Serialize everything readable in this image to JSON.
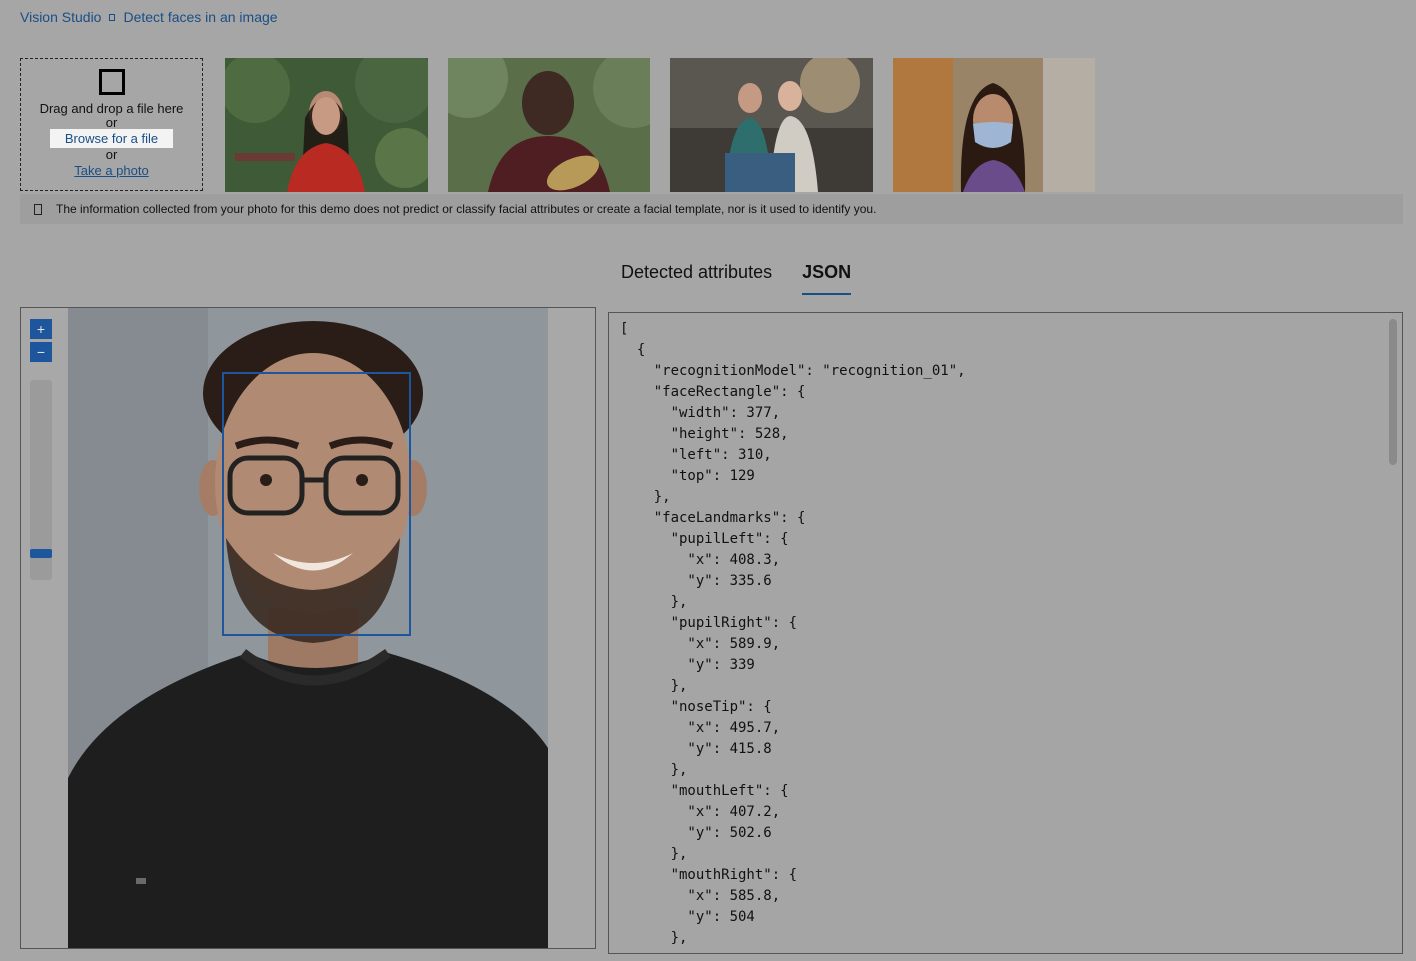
{
  "breadcrumb": {
    "root": "Vision Studio",
    "current": "Detect faces in an image"
  },
  "upload": {
    "drag_text": "Drag and drop a file here",
    "or_1": "or",
    "browse_label": "Browse for a file",
    "or_2": "or",
    "take_photo_label": "Take a photo"
  },
  "info": {
    "text": "The information collected from your photo for this demo does not predict or classify facial attributes or create a facial template, nor is it used to identify you."
  },
  "tabs": [
    {
      "label": "Detected attributes"
    },
    {
      "label": "JSON",
      "active": true
    }
  ],
  "zoom": {
    "plus": "+",
    "minus": "−",
    "level": 0.08
  },
  "json_output": "[\n  {\n    \"recognitionModel\": \"recognition_01\",\n    \"faceRectangle\": {\n      \"width\": 377,\n      \"height\": 528,\n      \"left\": 310,\n      \"top\": 129\n    },\n    \"faceLandmarks\": {\n      \"pupilLeft\": {\n        \"x\": 408.3,\n        \"y\": 335.6\n      },\n      \"pupilRight\": {\n        \"x\": 589.9,\n        \"y\": 339\n      },\n      \"noseTip\": {\n        \"x\": 495.7,\n        \"y\": 415.8\n      },\n      \"mouthLeft\": {\n        \"x\": 407.2,\n        \"y\": 502.6\n      },\n      \"mouthRight\": {\n        \"x\": 585.8,\n        \"y\": 504\n      },",
  "colors": {
    "accent": "#1d569c",
    "link": "#1a4e86",
    "overlay": "#a6a6a6"
  }
}
